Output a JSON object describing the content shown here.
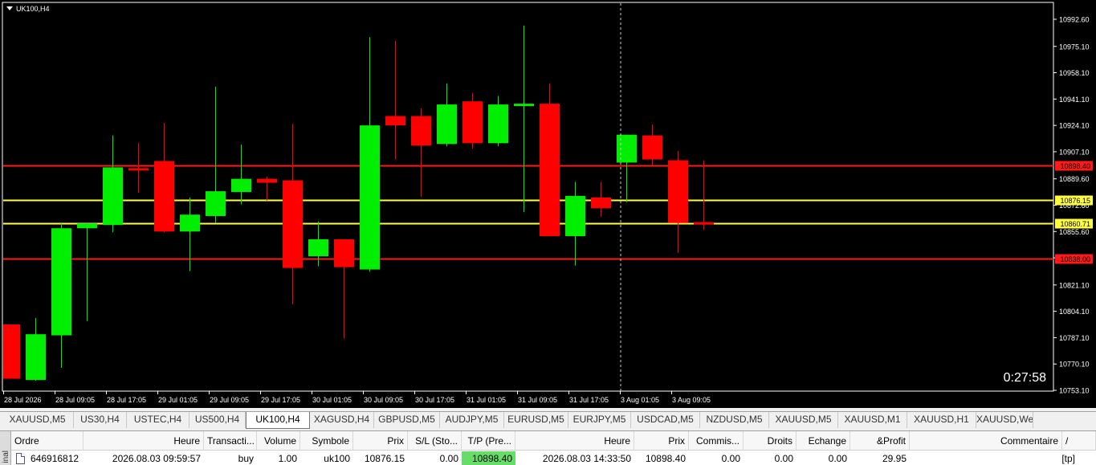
{
  "window": {
    "title": "UK100,H4"
  },
  "countdown": "0:27:58",
  "colors": {
    "bull": "#00ee00",
    "bear": "#ff0000",
    "sr_red": "#ff1a1a",
    "sr_yellow": "#ffff40",
    "grid": "#ffffff"
  },
  "chart_data": {
    "type": "candlestick",
    "symbol": "UK100",
    "timeframe": "H4",
    "y_ticks": [
      "10992.60",
      "10975.10",
      "10958.10",
      "10941.10",
      "10924.10",
      "10907.10",
      "10889.60",
      "10872.60",
      "10855.60",
      "10838.60",
      "10821.10",
      "10804.10",
      "10787.10",
      "10770.10",
      "10753.10"
    ],
    "x_labels": [
      "28 Jul 2026",
      "28 Jul 09:05",
      "28 Jul 17:05",
      "29 Jul 01:05",
      "29 Jul 09:05",
      "29 Jul 17:05",
      "30 Jul 01:05",
      "30 Jul 09:05",
      "30 Jul 17:05",
      "31 Jul 01:05",
      "31 Jul 09:05",
      "31 Jul 17:05",
      "3 Aug 01:05",
      "3 Aug 09:05"
    ],
    "candles": [
      {
        "o": 10795.6,
        "h": 10795.6,
        "l": 10760.6,
        "c": 10760.6
      },
      {
        "o": 10759.8,
        "h": 10799.8,
        "l": 10759.3,
        "c": 10789.3
      },
      {
        "o": 10788.6,
        "h": 10860.8,
        "l": 10767.6,
        "c": 10857.7
      },
      {
        "o": 10857.7,
        "h": 10861.3,
        "l": 10797.8,
        "c": 10860.8
      },
      {
        "o": 10859.8,
        "h": 10917.6,
        "l": 10855.1,
        "c": 10897.0
      },
      {
        "o": 10896.5,
        "h": 10912.6,
        "l": 10880.6,
        "c": 10896.0
      },
      {
        "o": 10901.1,
        "h": 10925.6,
        "l": 10855.1,
        "c": 10855.6
      },
      {
        "o": 10855.6,
        "h": 10877.6,
        "l": 10830.0,
        "c": 10866.5
      },
      {
        "o": 10865.6,
        "h": 10949.1,
        "l": 10861.3,
        "c": 10881.6
      },
      {
        "o": 10881.1,
        "h": 10911.6,
        "l": 10873.2,
        "c": 10889.6
      },
      {
        "o": 10889.6,
        "h": 10891.1,
        "l": 10875.6,
        "c": 10887.1
      },
      {
        "o": 10888.6,
        "h": 10925.1,
        "l": 10808.6,
        "c": 10832.1
      },
      {
        "o": 10839.6,
        "h": 10862.1,
        "l": 10833.1,
        "c": 10850.6
      },
      {
        "o": 10850.6,
        "h": 10850.6,
        "l": 10786.6,
        "c": 10832.6
      },
      {
        "o": 10831.1,
        "h": 10981.1,
        "l": 10829.6,
        "c": 10924.1
      },
      {
        "o": 10930.1,
        "h": 10978.6,
        "l": 10902.1,
        "c": 10924.1
      },
      {
        "o": 10930.1,
        "h": 10935.1,
        "l": 10878.1,
        "c": 10911.1
      },
      {
        "o": 10912.1,
        "h": 10951.1,
        "l": 10910.6,
        "c": 10937.6
      },
      {
        "o": 10939.6,
        "h": 10945.1,
        "l": 10909.1,
        "c": 10912.6
      },
      {
        "o": 10912.6,
        "h": 10943.1,
        "l": 10910.6,
        "c": 10937.6
      },
      {
        "o": 10937.6,
        "h": 10988.6,
        "l": 10868.1,
        "c": 10938.1
      },
      {
        "o": 10938.1,
        "h": 10951.1,
        "l": 10872.1,
        "c": 10852.6
      },
      {
        "o": 10852.6,
        "h": 10887.6,
        "l": 10833.6,
        "c": 10878.6
      },
      {
        "o": 10877.6,
        "h": 10887.6,
        "l": 10865.1,
        "c": 10870.6
      },
      {
        "o": 10900.1,
        "h": 10917.6,
        "l": 10874.6,
        "c": 10918.1
      },
      {
        "o": 10917.6,
        "h": 10924.6,
        "l": 10898.6,
        "c": 10902.1
      },
      {
        "o": 10901.6,
        "h": 10907.6,
        "l": 10841.6,
        "c": 10861.1
      },
      {
        "o": 10861.6,
        "h": 10901.6,
        "l": 10856.6,
        "c": 10860.6
      }
    ],
    "levels": [
      {
        "price": 10898.4,
        "label": "10898.40",
        "color": "#ff1a1a"
      },
      {
        "price": 10876.15,
        "label": "10876.15",
        "color": "#ffff40"
      },
      {
        "price": 10860.71,
        "label": "10860.71",
        "color": "#ffff40"
      },
      {
        "price": 10838.0,
        "label": "10838.00",
        "color": "#ff1a1a"
      }
    ],
    "ylim": [
      10753.1,
      10992.6
    ]
  },
  "tabs": [
    {
      "label": "XAUUSD,M5"
    },
    {
      "label": "US30,H4"
    },
    {
      "label": "USTEC,H4"
    },
    {
      "label": "US500,H4"
    },
    {
      "label": "UK100,H4",
      "active": true
    },
    {
      "label": "XAGUSD,H4"
    },
    {
      "label": "GBPUSD,M5"
    },
    {
      "label": "AUDJPY,M5"
    },
    {
      "label": "EURUSD,M5"
    },
    {
      "label": "EURJPY,M5"
    },
    {
      "label": "USDCAD,M5"
    },
    {
      "label": "NZDUSD,M5"
    },
    {
      "label": "XAUUSD,M5"
    },
    {
      "label": "XAUUSD,M1"
    },
    {
      "label": "XAUUSD,H1"
    },
    {
      "label": "XAUUSD,Weekl"
    }
  ],
  "terminal": {
    "side_label": "inal",
    "headers": {
      "ordre": "Ordre",
      "heure": "Heure",
      "transaction": "Transacti...",
      "volume": "Volume",
      "symbole": "Symbole",
      "prix": "Prix",
      "sl": "S/L (Sto...",
      "tp": "T/P (Pre...",
      "heure2": "Heure",
      "prix2": "Prix",
      "commission": "Commis...",
      "droits": "Droits",
      "echange": "Echange",
      "profit": "&Profit",
      "commentaire": "Commentaire",
      "sort": "/"
    },
    "row": {
      "ordre": "646916812",
      "heure": "2026.08.03 09:59:57",
      "transaction": "buy",
      "volume": "1.00",
      "symbole": "uk100",
      "prix": "10876.15",
      "sl": "0.00",
      "tp": "10898.40",
      "heure2": "2026.08.03 14:33:50",
      "prix2": "10898.40",
      "commission": "0.00",
      "droits": "0.00",
      "echange": "0.00",
      "profit": "29.95",
      "commentaire": "[tp]"
    }
  }
}
